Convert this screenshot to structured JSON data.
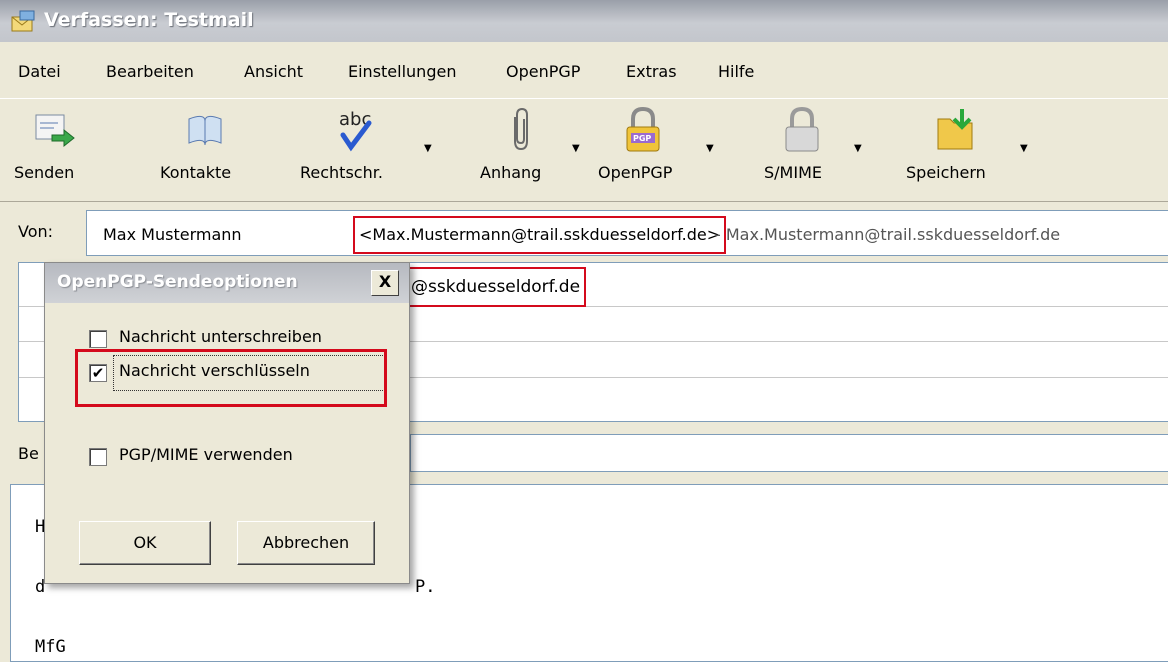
{
  "window": {
    "title": "Verfassen: Testmail"
  },
  "menu": [
    "Datei",
    "Bearbeiten",
    "Ansicht",
    "Einstellungen",
    "OpenPGP",
    "Extras",
    "Hilfe"
  ],
  "toolbar": {
    "send": "Senden",
    "contacts": "Kontakte",
    "spelling": "Rechtschr.",
    "attach": "Anhang",
    "openpgp": "OpenPGP",
    "smime": "S/MIME",
    "save": "Speichern"
  },
  "from": {
    "label": "Von:",
    "name": "Max Mustermann",
    "address": "<Max.Mustermann@trail.sskduesseldorf.de>",
    "account": "- Max.Mustermann@trail.sskduesseldorf.de"
  },
  "recipient": {
    "address_visible": "@sskduesseldorf.de"
  },
  "subject": {
    "label_visible": "Be"
  },
  "body": {
    "lines": [
      "H",
      "d",
      "P.",
      "MfG"
    ]
  },
  "dialog": {
    "title": "OpenPGP-Sendeoptionen",
    "close": "X",
    "sign": {
      "label": "Nachricht unterschreiben",
      "checked": false
    },
    "encrypt": {
      "label": "Nachricht verschlüsseln",
      "checked": true
    },
    "pgpmime": {
      "label": "PGP/MIME verwenden",
      "checked": false
    },
    "ok": "OK",
    "cancel": "Abbrechen",
    "check_mark": "✔"
  },
  "colors": {
    "highlight": "#d40a1c",
    "window_bg": "#ece9d8"
  }
}
